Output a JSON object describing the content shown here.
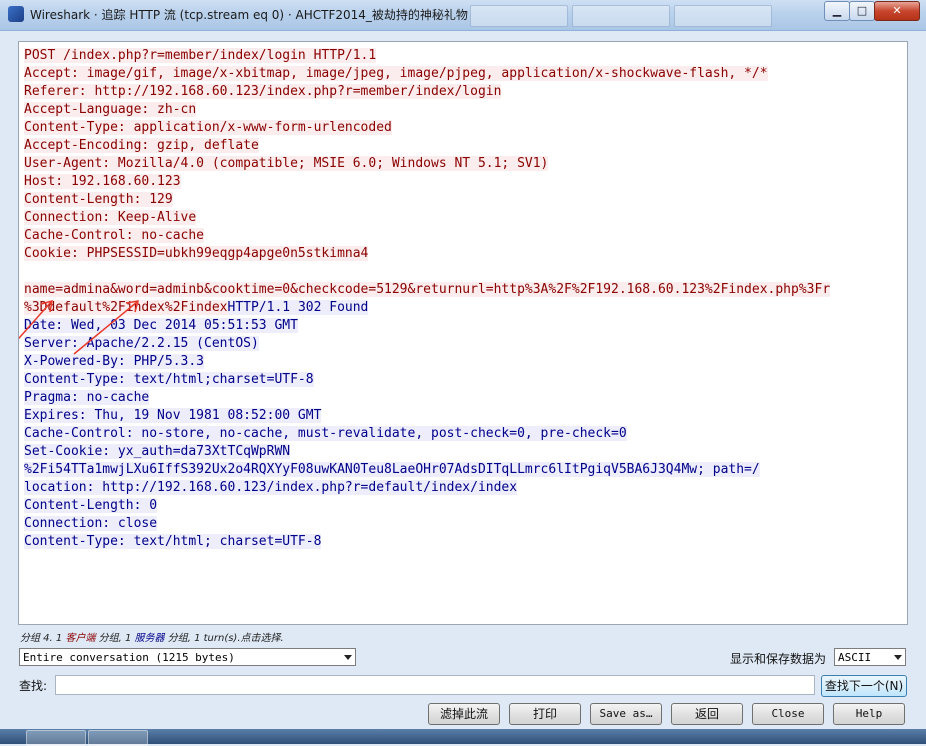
{
  "window": {
    "title": "Wireshark · 追踪 HTTP 流 (tcp.stream eq 0) · AHCTF2014_被劫持的神秘礼物",
    "minimize_glyph": "▁",
    "maximize_glyph": "□",
    "close_glyph": "✕"
  },
  "stream": {
    "lines": [
      [
        {
          "t": "POST /index.php?r=member/index/login HTTP/1.1",
          "k": "c"
        }
      ],
      [
        {
          "t": "Accept: image/gif, image/x-xbitmap, image/jpeg, image/pjpeg, application/x-shockwave-flash, */*",
          "k": "c"
        }
      ],
      [
        {
          "t": "Referer: http://192.168.60.123/index.php?r=member/index/login",
          "k": "c"
        }
      ],
      [
        {
          "t": "Accept-Language: zh-cn",
          "k": "c"
        }
      ],
      [
        {
          "t": "Content-Type: application/x-www-form-urlencoded",
          "k": "c"
        }
      ],
      [
        {
          "t": "Accept-Encoding: gzip, deflate",
          "k": "c"
        }
      ],
      [
        {
          "t": "User-Agent: Mozilla/4.0 (compatible; MSIE 6.0; Windows NT 5.1; SV1)",
          "k": "c"
        }
      ],
      [
        {
          "t": "Host: 192.168.60.123",
          "k": "c"
        }
      ],
      [
        {
          "t": "Content-Length: 129",
          "k": "c"
        }
      ],
      [
        {
          "t": "Connection: Keep-Alive",
          "k": "c"
        }
      ],
      [
        {
          "t": "Cache-Control: no-cache",
          "k": "c"
        }
      ],
      [
        {
          "t": "Cookie: PHPSESSID=ubkh99eqgp4apge0n5stkimna4",
          "k": "c"
        }
      ],
      [],
      [
        {
          "t": "name=admina&word=adminb&cooktime=0&checkcode=5129&returnurl=http%3A%2F%2F192.168.60.123%2Findex.php%3Fr",
          "k": "c"
        }
      ],
      [
        {
          "t": "%3Ddefault%2Findex%2Findex",
          "k": "c"
        },
        {
          "t": "HTTP/1.1 302 Found",
          "k": "s"
        }
      ],
      [
        {
          "t": "Date: Wed, 03 Dec 2014 05:51:53 GMT",
          "k": "s"
        }
      ],
      [
        {
          "t": "Server: Apache/2.2.15 (CentOS)",
          "k": "s"
        }
      ],
      [
        {
          "t": "X-Powered-By: PHP/5.3.3",
          "k": "s"
        }
      ],
      [
        {
          "t": "Content-Type: text/html;charset=UTF-8",
          "k": "s"
        }
      ],
      [
        {
          "t": "Pragma: no-cache",
          "k": "s"
        }
      ],
      [
        {
          "t": "Expires: Thu, 19 Nov 1981 08:52:00 GMT",
          "k": "s"
        }
      ],
      [
        {
          "t": "Cache-Control: no-store, no-cache, must-revalidate, post-check=0, pre-check=0",
          "k": "s"
        }
      ],
      [
        {
          "t": "Set-Cookie: yx_auth=da73XtTCqWpRWN",
          "k": "s"
        }
      ],
      [
        {
          "t": "%2Fi54TTa1mwjLXu6IffS392Ux2o4RQXYyF08uwKAN0Teu8LaeOHr07AdsDITqLLmrc6lItPgiqV5BA6J3Q4Mw; path=/",
          "k": "s"
        }
      ],
      [
        {
          "t": "location: http://192.168.60.123/index.php?r=default/index/index",
          "k": "s"
        }
      ],
      [
        {
          "t": "Content-Length: 0",
          "k": "s"
        }
      ],
      [
        {
          "t": "Connection: close",
          "k": "s"
        }
      ],
      [
        {
          "t": "Content-Type: text/html; charset=UTF-8",
          "k": "s"
        }
      ]
    ],
    "client_color": "#8b0000",
    "server_color": "#00008b",
    "annotation_color": "#e8392a"
  },
  "status": {
    "prefix": "分组 4. 1 ",
    "client": "客户端",
    "mid": " 分组, 1 ",
    "server": "服务器",
    "suffix": " 分组, 1 turn(s).点击选择."
  },
  "controls": {
    "conversation_select": "Entire conversation (1215 bytes)",
    "show_save_label": "显示和保存数据为",
    "format_select": "ASCII",
    "find_label": "查找:",
    "find_value": "",
    "find_next_label": "查找下一个(N)",
    "filter_out_label": "滤掉此流",
    "print_label": "打印",
    "save_as_label": "Save as…",
    "back_label": "返回",
    "close_label": "Close",
    "help_label": "Help"
  }
}
